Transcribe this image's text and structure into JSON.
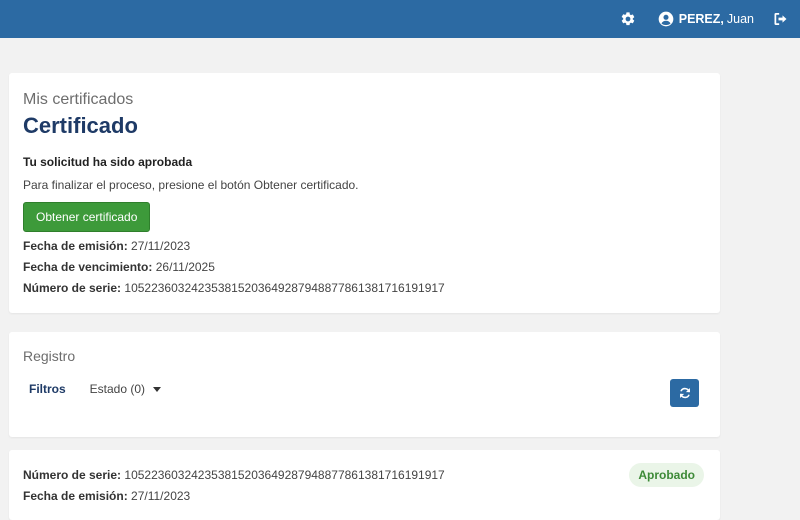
{
  "header": {
    "user": {
      "last_name": "PEREZ,",
      "first_name": "Juan"
    },
    "icons": [
      "gear-icon",
      "user-circle-icon",
      "logout-icon"
    ]
  },
  "certificate_card": {
    "overline": "Mis certificados",
    "title": "Certificado",
    "status_title": "Tu solicitud ha sido aprobada",
    "description": "Para finalizar el proceso, presione el botón Obtener certificado.",
    "button_label": "Obtener certificado",
    "issue_label": "Fecha de emisión:",
    "issue_date": "27/11/2023",
    "expiry_label": "Fecha de vencimiento:",
    "expiry_date": "26/11/2025",
    "serial_label": "Número de serie:",
    "serial_number": "105223603242353815203649287948877861381716191917"
  },
  "registry": {
    "title": "Registro",
    "filters_label": "Filtros",
    "status_filter": "Estado (0)"
  },
  "record": {
    "serial_label": "Número de serie:",
    "serial_number": "105223603242353815203649287948877861381716191917",
    "issue_label": "Fecha de emisión:",
    "issue_date": "27/11/2023",
    "status_badge": "Aprobado"
  },
  "colors": {
    "header": "#2c6aa3",
    "title": "#1e3a66",
    "primary_button": "#3d9a3a",
    "badge_text": "#3d8a37",
    "badge_bg": "#eaf5e8"
  }
}
